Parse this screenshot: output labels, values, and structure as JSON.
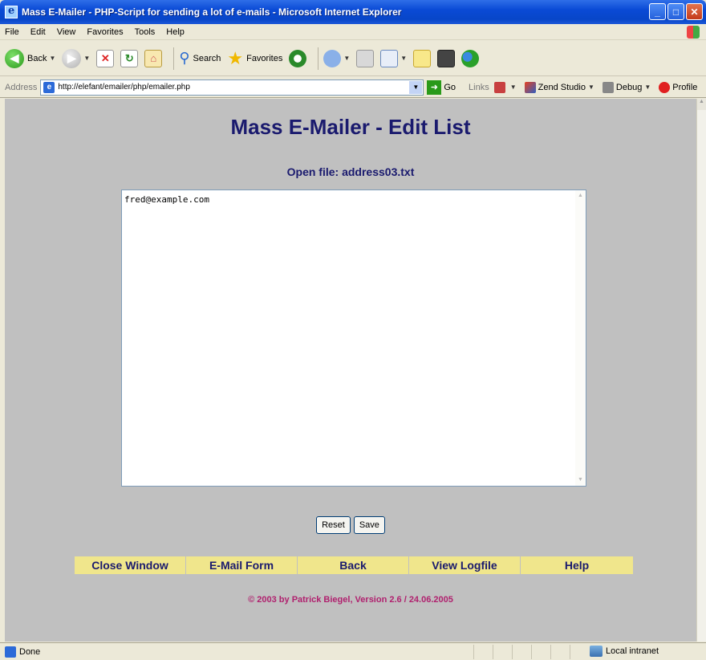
{
  "window": {
    "title": "Mass E-Mailer - PHP-Script for sending a lot of e-mails - Microsoft Internet Explorer"
  },
  "menu": [
    "File",
    "Edit",
    "View",
    "Favorites",
    "Tools",
    "Help"
  ],
  "toolbar": {
    "back_label": "Back",
    "search_label": "Search",
    "favorites_label": "Favorites"
  },
  "address": {
    "label": "Address",
    "url": "http://elefant/emailer/php/emailer.php",
    "go_label": "Go",
    "links_label": "Links",
    "zend_label": "Zend Studio",
    "debug_label": "Debug",
    "profile_label": "Profile"
  },
  "page": {
    "title": "Mass E-Mailer - Edit List",
    "open_file": "Open file: address03.txt",
    "textarea_value": "fred@example.com",
    "reset_label": "Reset",
    "save_label": "Save",
    "nav": [
      "Close Window",
      "E-Mail Form",
      "Back",
      "View Logfile",
      "Help"
    ],
    "copyright": "© 2003 by Patrick Biegel, Version 2.6 / 24.06.2005"
  },
  "status": {
    "text": "Done",
    "zone": "Local intranet"
  },
  "colors": {
    "page_bg": "#c0c0c0",
    "heading": "#1a1a6e",
    "nav_bg": "#f0e68c",
    "copyright": "#b0206e"
  }
}
